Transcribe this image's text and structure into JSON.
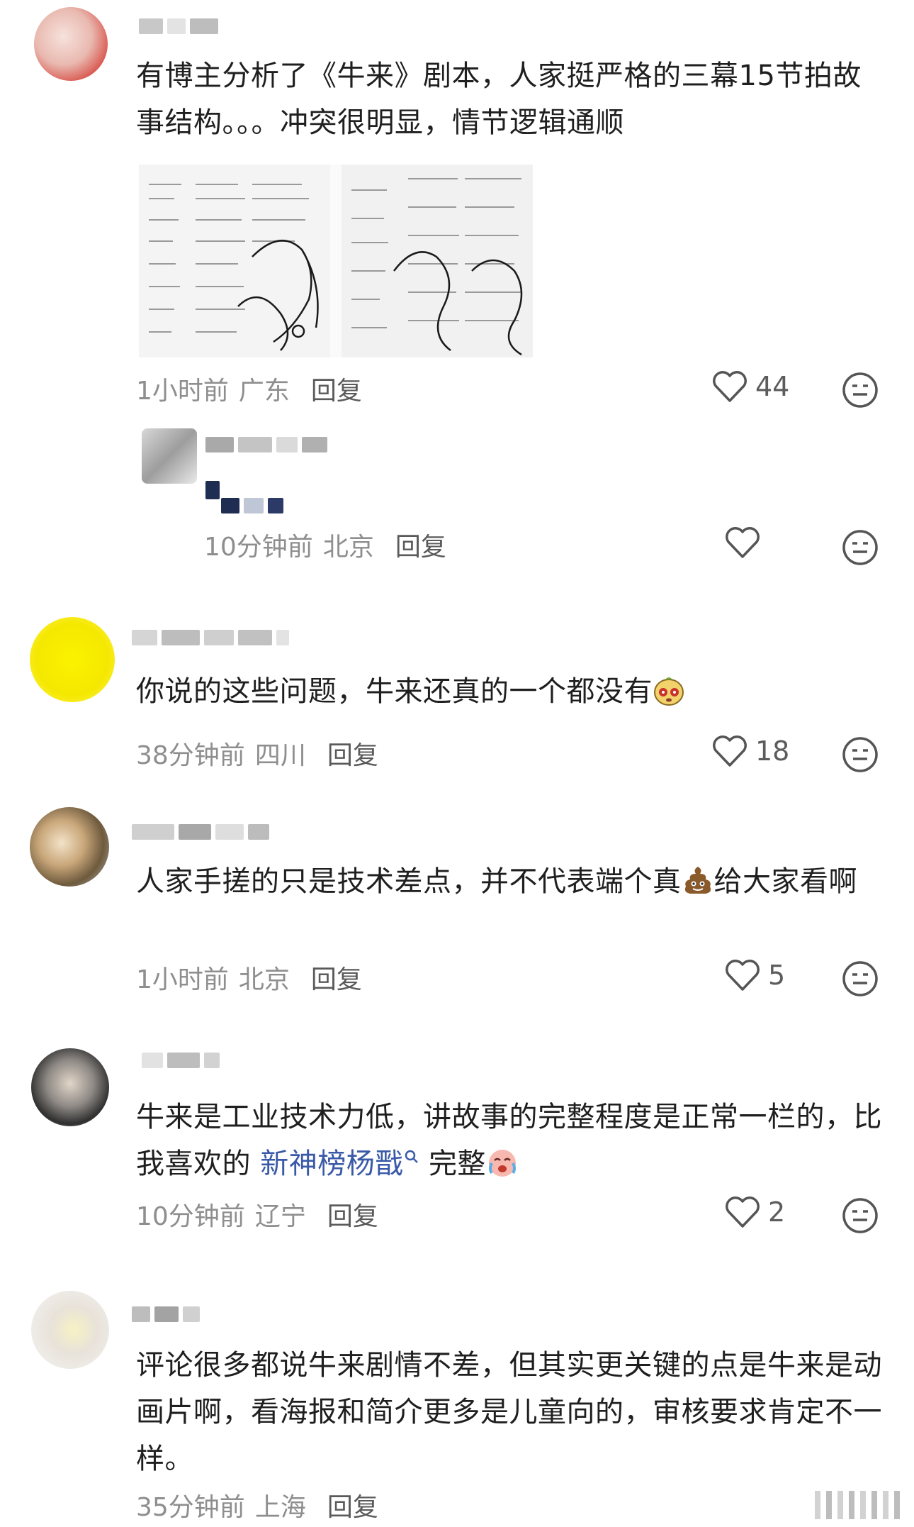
{
  "comments": [
    {
      "text": "有博主分析了《牛来》剧本，人家挺严格的三幕15节拍故事结构。。。冲突很明显，情节逻辑通顺",
      "time": "1小时前",
      "location": "广东",
      "reply": "回复",
      "likes": "44",
      "has_image": true
    },
    {
      "text": "",
      "time": "10分钟前",
      "location": "北京",
      "reply": "回复",
      "likes": ""
    },
    {
      "text": "你说的这些问题，牛来还真的一个都没有",
      "time": "38分钟前",
      "location": "四川",
      "reply": "回复",
      "likes": "18"
    },
    {
      "text_a": "人家手搓的只是技术差点，并不代表端个真",
      "text_b": "给大家看啊",
      "time": "1小时前",
      "location": "北京",
      "reply": "回复",
      "likes": "5"
    },
    {
      "text_a": "牛来是工业技术力低，讲故事的完整程度是正常一栏的，比我喜欢的",
      "link": "新神榜杨戬",
      "text_b": "完整",
      "time": "10分钟前",
      "location": "辽宁",
      "reply": "回复",
      "likes": "2"
    },
    {
      "text": "评论很多都说牛来剧情不差，但其实更关键的点是牛来是动画片啊，看海报和简介更多是儿童向的，审核要求肯定不一样。",
      "time": "35分钟前",
      "location": "上海",
      "reply": "回复"
    }
  ],
  "colors": {
    "text": "#1f1f1f",
    "meta": "#8e8e8e",
    "link": "#3a5aa8"
  },
  "icons": {
    "like": "heart-outline-icon",
    "react": "neutral-face-icon"
  }
}
